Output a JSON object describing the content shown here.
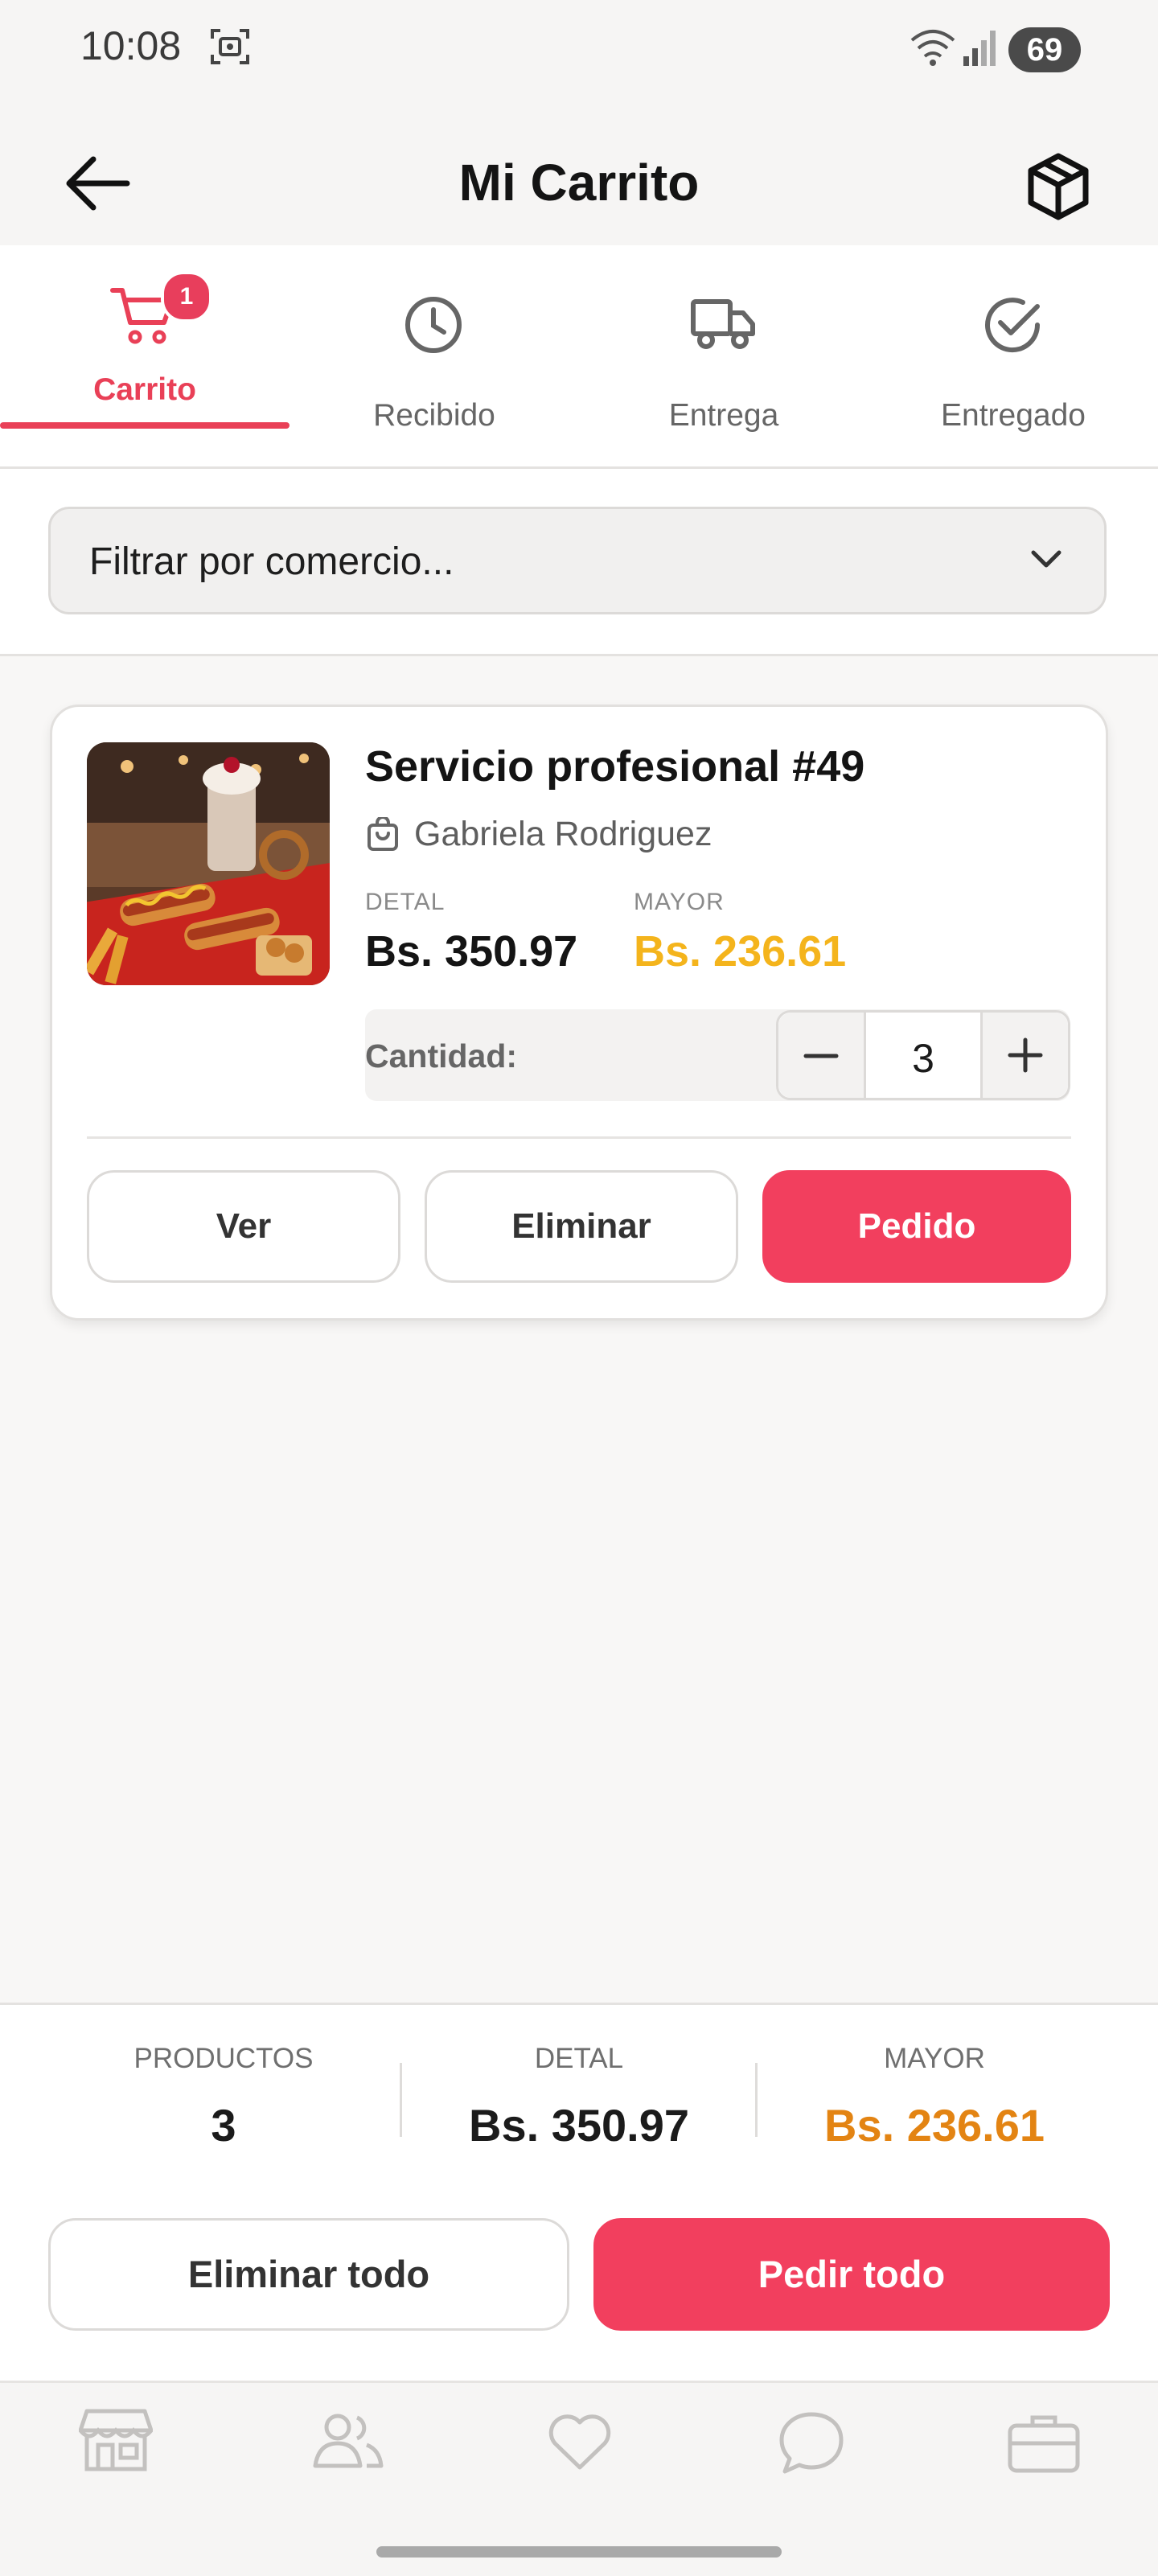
{
  "status_bar": {
    "time": "10:08",
    "battery": "69",
    "icons": [
      "screenshot-icon",
      "wifi-icon",
      "signal-icon",
      "battery-icon"
    ]
  },
  "header": {
    "title": "Mi Carrito",
    "back_icon": "arrow-left-icon",
    "action_icon": "package-icon"
  },
  "tabs": [
    {
      "label": "Carrito",
      "icon": "cart-icon",
      "active": true,
      "badge": "1"
    },
    {
      "label": "Recibido",
      "icon": "clock-icon",
      "active": false
    },
    {
      "label": "Entrega",
      "icon": "truck-icon",
      "active": false
    },
    {
      "label": "Entregado",
      "icon": "check-circle-icon",
      "active": false
    }
  ],
  "filter": {
    "placeholder": "Filtrar por comercio..."
  },
  "cart_item": {
    "title": "Servicio profesional #49",
    "seller": "Gabriela Rodriguez",
    "retail_label": "DETAL",
    "retail_price": "Bs. 350.97",
    "wholesale_label": "MAYOR",
    "wholesale_price": "Bs. 236.61",
    "quantity_label": "Cantidad:",
    "quantity": "3",
    "buttons": {
      "view": "Ver",
      "remove": "Eliminar",
      "order": "Pedido"
    }
  },
  "summary": {
    "products_label": "PRODUCTOS",
    "products_value": "3",
    "retail_label": "DETAL",
    "retail_value": "Bs. 350.97",
    "wholesale_label": "MAYOR",
    "wholesale_value": "Bs. 236.61",
    "remove_all": "Eliminar todo",
    "order_all": "Pedir todo"
  },
  "bottom_nav": [
    "store-icon",
    "users-icon",
    "heart-icon",
    "chat-icon",
    "briefcase-icon"
  ],
  "colors": {
    "accent": "#f23f5e",
    "wholesale": "#f4b41c",
    "wholesale_summary": "#e38413"
  }
}
